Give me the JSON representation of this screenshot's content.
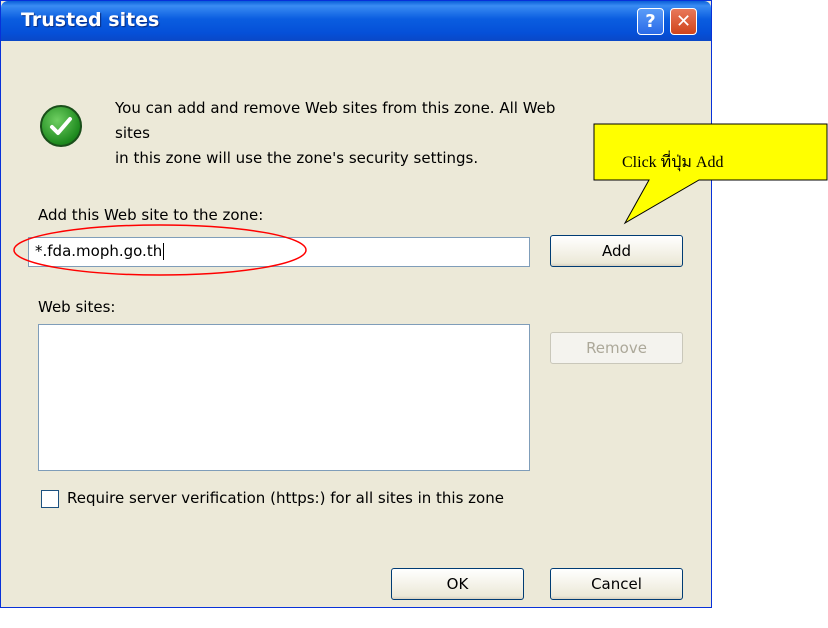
{
  "window": {
    "title": "Trusted sites",
    "help_glyph": "?",
    "close_glyph": "✕"
  },
  "intro": {
    "line1": "You can add and remove Web sites from this zone. All Web sites",
    "line2": "in this zone will use the zone's security settings.",
    "icon": "green-check-icon"
  },
  "add_site": {
    "label": "Add this Web site to the zone:",
    "value": "*.fda.moph.go.th",
    "button_label": "Add"
  },
  "web_sites": {
    "label": "Web sites:",
    "items": [],
    "remove_label": "Remove"
  },
  "verification": {
    "label": "Require server verification (https:) for all sites in this zone",
    "checked": false
  },
  "footer": {
    "ok_label": "OK",
    "cancel_label": "Cancel"
  },
  "annotation": {
    "callout_text": "Click ที่ปุ่ม Add",
    "callout_color": "#ffff00",
    "highlight_color": "#ff0000"
  }
}
